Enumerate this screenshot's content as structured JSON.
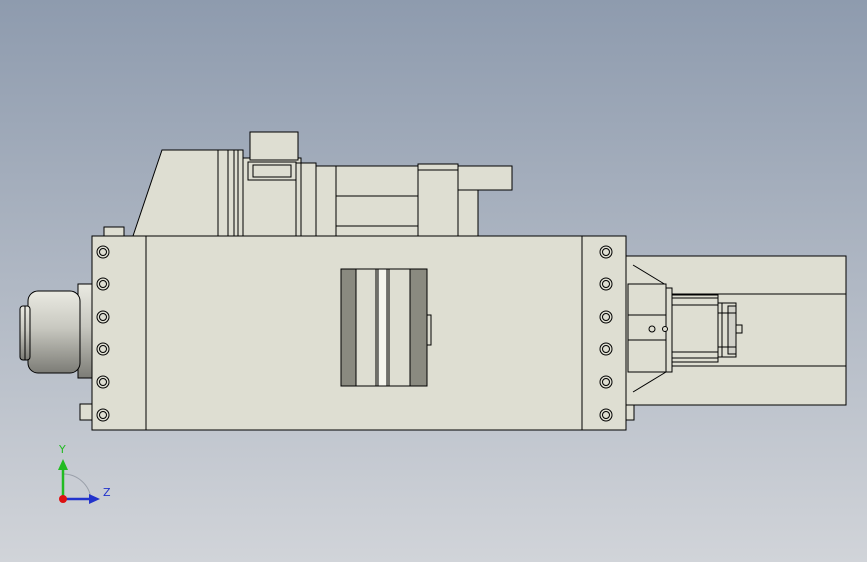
{
  "viewport": {
    "background_top": "#8e9bae",
    "background_bottom": "#d1d4d9"
  },
  "model": {
    "fill_color": "#deded2",
    "edge_color": "#000000",
    "dark_fill_color": "#8a8a80",
    "motor_fill_color": "#d0d0c8"
  },
  "triad": {
    "y_label": "Y",
    "z_label": "Z",
    "y_color": "#22bb22",
    "z_color": "#2233cc",
    "x_color": "#dd1111"
  }
}
